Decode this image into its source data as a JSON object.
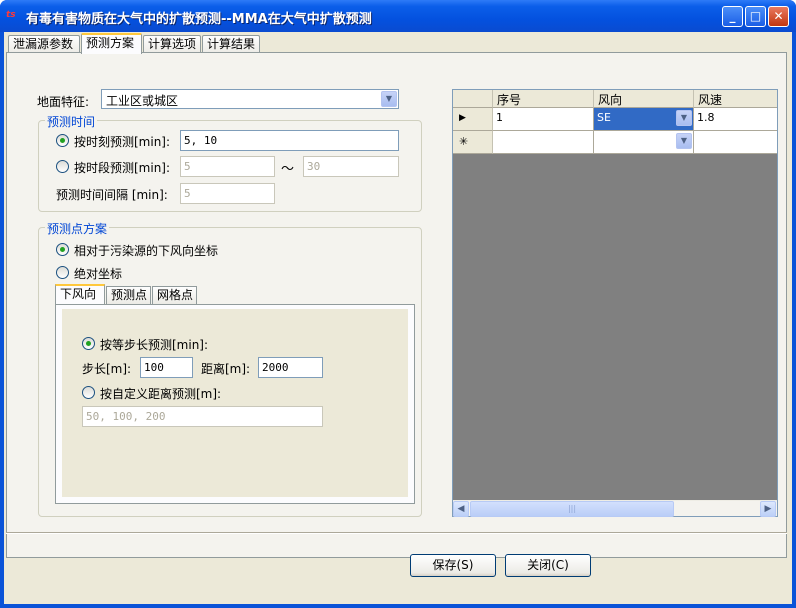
{
  "window": {
    "app_icon": "ts",
    "title": "有毒有害物质在大气中的扩散预测--MMA在大气中扩散预测",
    "minimize": "_",
    "maximize": "□",
    "close": "✕"
  },
  "tabs": [
    {
      "label": "泄漏源参数",
      "active": false
    },
    {
      "label": "预测方案",
      "active": true
    },
    {
      "label": "计算选项",
      "active": false
    },
    {
      "label": "计算结果",
      "active": false
    }
  ],
  "ground": {
    "label": "地面特征:",
    "value": "工业区或城区"
  },
  "time_group": {
    "title": "预测时间",
    "moment_label": "按时刻预测[min]:",
    "moment_value": "5, 10",
    "period_label": "按时段预测[min]:",
    "period_from": "5",
    "tilde": "～",
    "period_to": "30",
    "interval_label": "预测时间间隔 [min]:",
    "interval_value": "5"
  },
  "point_group": {
    "title": "预测点方案",
    "relative_label": "相对于污染源的下风向坐标",
    "absolute_label": "绝对坐标",
    "subtabs": [
      "下风向",
      "预测点",
      "网格点"
    ],
    "equal_step_label": "按等步长预测[min]:",
    "step_label": "步长[m]:",
    "step_value": "100",
    "distance_label": "距离[m]:",
    "distance_value": "2000",
    "custom_label": "按自定义距离预测[m]:",
    "custom_value": "50, 100, 200"
  },
  "grid": {
    "columns": [
      "序号",
      "风向",
      "风速"
    ],
    "rows": [
      {
        "indicator": "▶",
        "no": "1",
        "dir": "SE",
        "speed": "1.8"
      },
      {
        "indicator": "✳",
        "no": "",
        "dir": "",
        "speed": ""
      }
    ],
    "scroll_thumb": "|||"
  },
  "buttons": {
    "save": "保存(S)",
    "close": "关闭(C)"
  },
  "icons": {
    "dropdown": "chevron-down-icon",
    "scroll_left": "arrow-left-icon",
    "scroll_right": "arrow-right-icon"
  }
}
